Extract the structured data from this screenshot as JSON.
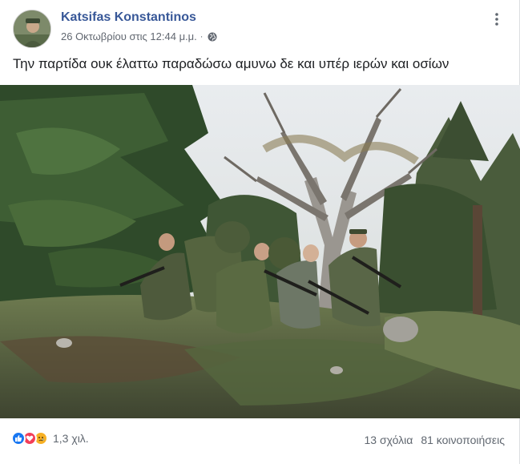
{
  "post": {
    "author": "Katsifas Konstantinos",
    "timestamp": "26 Οκτωβρίου στις 12:44 μ.μ.",
    "separator": "·",
    "privacy_icon": "globe-icon",
    "more_icon": "more-options-icon",
    "text": "Την παρτίδα ουκ έλαττω παραδώσω αμυνω δε και υπέρ ιερών και οσίων"
  },
  "photo": {
    "icon": "photo-soldiers-in-forest"
  },
  "footer": {
    "reaction_icons": [
      "like-icon",
      "love-icon",
      "sad-icon"
    ],
    "reaction_count": "1,3 χιλ.",
    "comments": "13 σχόλια",
    "shares": "81 κοινοποιήσεις"
  },
  "colors": {
    "author": "#385898",
    "meta": "#616770",
    "like": "#1877f2",
    "love": "#f33e58",
    "sad": "#f7b125"
  }
}
